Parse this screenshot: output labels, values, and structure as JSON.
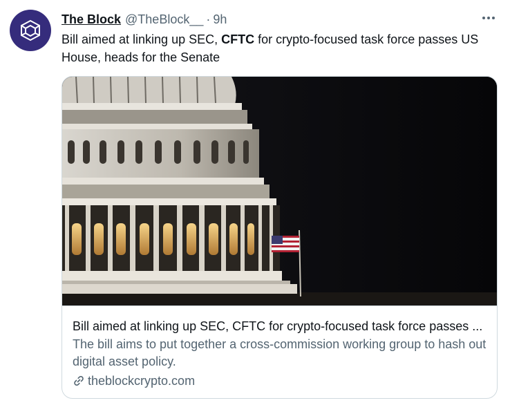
{
  "tweet": {
    "author": {
      "display_name": "The Block",
      "handle": "@TheBlock__",
      "separator": "·",
      "timestamp": "9h",
      "avatar_icon": "cube-logo-icon",
      "avatar_color": "#352c7c"
    },
    "text": {
      "before": "Bill aimed at linking up SEC, ",
      "bold": "CFTC",
      "after": " for crypto-focused task force passes US House, heads for the Senate"
    },
    "more_icon": "more-horizontal-icon"
  },
  "card": {
    "image_subject": "capitol-dome-photo",
    "title": "Bill aimed at linking up SEC, CFTC for crypto-focused task force passes ...",
    "description": "The bill aims to put together a cross-commission working group to hash out digital asset policy.",
    "domain": "theblockcrypto.com",
    "link_icon": "link-icon"
  },
  "colors": {
    "text_primary": "#0f1419",
    "text_secondary": "#536471",
    "border": "#cfd9de"
  }
}
